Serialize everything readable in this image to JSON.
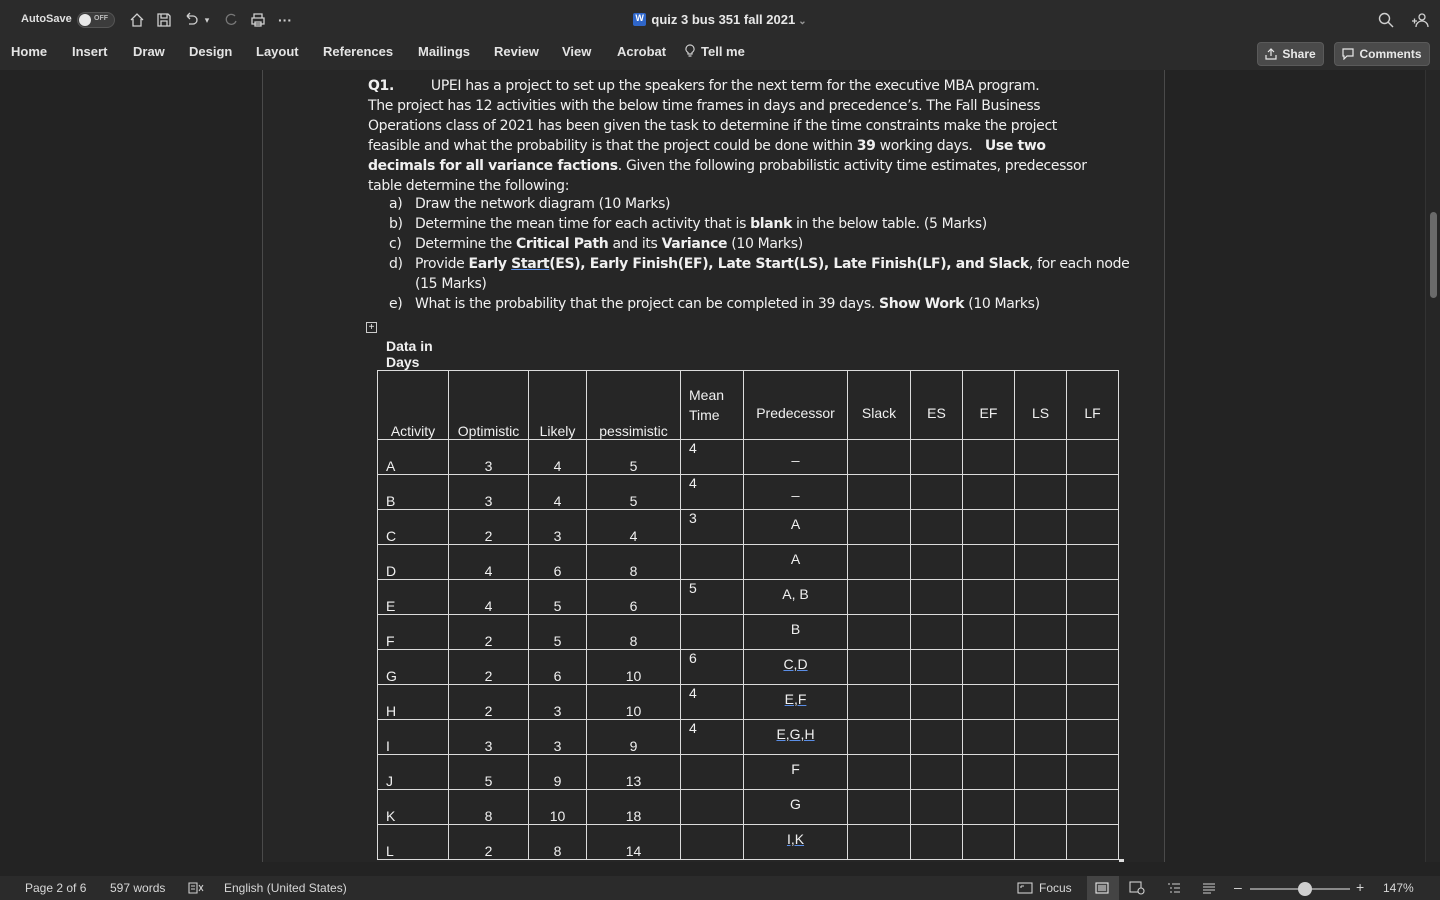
{
  "titlebar": {
    "autosave_label": "AutoSave",
    "autosave_state": "OFF",
    "document_title": "quiz 3 bus 351 fall 2021",
    "icons": [
      "home-icon",
      "save-icon",
      "undo-icon",
      "redo-icon",
      "print-icon",
      "more-icon",
      "search-icon",
      "collaborate-icon"
    ]
  },
  "ribbon": {
    "tabs": [
      "Home",
      "Insert",
      "Draw",
      "Design",
      "Layout",
      "References",
      "Mailings",
      "Review",
      "View",
      "Acrobat",
      "Tell me"
    ],
    "share_label": "Share",
    "comments_label": "Comments"
  },
  "document": {
    "q_label": "Q1.",
    "para": [
      "UPEI has a project to set up the speakers for the next term for the executive MBA program.",
      "The project has 12 activities with the below time frames in days and precedence’s.   The Fall Business",
      "Operations class of 2021 has been given the task to determine if the time constraints make the project",
      "feasible and what the probability is that the project could be done within ",
      "39",
      " working days.   ",
      "Use two",
      "decimals for all variance factions",
      ". Given the following probabilistic activity time estimates, predecessor",
      "table determine the following:"
    ],
    "list": [
      {
        "marker": "a)",
        "parts": [
          {
            "t": "Draw the network diagram (10 Marks)"
          }
        ]
      },
      {
        "marker": "b)",
        "parts": [
          {
            "t": "Determine the mean time for each activity that is "
          },
          {
            "t": "blank",
            "b": true
          },
          {
            "t": " in the below table. (5 Marks)"
          }
        ]
      },
      {
        "marker": "c)",
        "parts": [
          {
            "t": "Determine the "
          },
          {
            "t": "Critical Path",
            "b": true
          },
          {
            "t": " and its "
          },
          {
            "t": "Variance",
            "b": true
          },
          {
            "t": " (10 Marks)"
          }
        ]
      },
      {
        "marker": "d)",
        "parts": [
          {
            "t": "Provide "
          },
          {
            "t": "Early ",
            "b": true
          },
          {
            "t": "Start",
            "b": true,
            "u": true
          },
          {
            "t": "(ES), Early Finish(EF), Late Start(LS), Late Finish(LF), and Slack",
            "b": true
          },
          {
            "t": ", for each node"
          }
        ]
      },
      {
        "marker": "",
        "parts": [
          {
            "t": "(15 Marks)"
          }
        ]
      },
      {
        "marker": "e)",
        "parts": [
          {
            "t": "What is the probability that the project can be completed in 39 days. "
          },
          {
            "t": "Show Work",
            "b": true
          },
          {
            "t": " (10 Marks)"
          }
        ]
      }
    ],
    "table_caption_line1": "Data in",
    "table_caption_line2": "Days",
    "table": {
      "headers": [
        "Activity",
        "Optimistic",
        "Likely",
        "pessimistic",
        "Mean Time",
        "Predecessor",
        "Slack",
        "ES",
        "EF",
        "LS",
        "LF"
      ],
      "rows": [
        {
          "activity": "A",
          "optimistic": "3",
          "likely": "4",
          "pessimistic": "5",
          "mean": "4",
          "pred": "_",
          "pred_underline": false
        },
        {
          "activity": "B",
          "optimistic": "3",
          "likely": "4",
          "pessimistic": "5",
          "mean": "4",
          "pred": "_",
          "pred_underline": false
        },
        {
          "activity": "C",
          "optimistic": "2",
          "likely": "3",
          "pessimistic": "4",
          "mean": "3",
          "pred": "A",
          "pred_underline": false
        },
        {
          "activity": "D",
          "optimistic": "4",
          "likely": "6",
          "pessimistic": "8",
          "mean": "",
          "pred": "A",
          "pred_underline": false
        },
        {
          "activity": "E",
          "optimistic": "4",
          "likely": "5",
          "pessimistic": "6",
          "mean": "5",
          "pred": "A, B",
          "pred_underline": false
        },
        {
          "activity": "F",
          "optimistic": "2",
          "likely": "5",
          "pessimistic": "8",
          "mean": "",
          "pred": "B",
          "pred_underline": false
        },
        {
          "activity": "G",
          "optimistic": "2",
          "likely": "6",
          "pessimistic": "10",
          "mean": "6",
          "pred": "C,D",
          "pred_underline": true
        },
        {
          "activity": "H",
          "optimistic": "2",
          "likely": "3",
          "pessimistic": "10",
          "mean": "4",
          "pred": "E,F",
          "pred_underline": true
        },
        {
          "activity": "I",
          "optimistic": "3",
          "likely": "3",
          "pessimistic": "9",
          "mean": "4",
          "pred": "E,G,H",
          "pred_underline": true
        },
        {
          "activity": "J",
          "optimistic": "5",
          "likely": "9",
          "pessimistic": "13",
          "mean": "",
          "pred": "F",
          "pred_underline": false
        },
        {
          "activity": "K",
          "optimistic": "8",
          "likely": "10",
          "pessimistic": "18",
          "mean": "",
          "pred": "G",
          "pred_underline": false
        },
        {
          "activity": "L",
          "optimistic": "2",
          "likely": "8",
          "pessimistic": "14",
          "mean": "",
          "pred": "I,K",
          "pred_underline": true
        }
      ]
    }
  },
  "statusbar": {
    "page": "Page 2 of 6",
    "words": "597 words",
    "language": "English (United States)",
    "focus": "Focus",
    "zoom": "147%",
    "zoom_level_fraction": 0.55
  }
}
